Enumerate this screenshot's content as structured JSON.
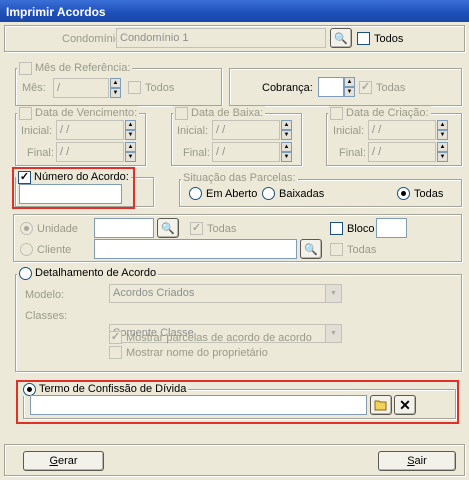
{
  "window": {
    "title": "Imprimir Acordos"
  },
  "condominio": {
    "label": "Condomínio:",
    "value": "Condomínio 1",
    "todos_label": "Todos"
  },
  "mes_ref": {
    "legend": "Mês de Referência:",
    "mes_label": "Mês:",
    "mes_value": "/",
    "todos_label": "Todos"
  },
  "cobranca": {
    "label": "Cobrança:",
    "value": "",
    "todas_label": "Todas"
  },
  "vencimento": {
    "legend": "Data de Vencimento:",
    "inicial_label": "Inicial:",
    "inicial_value": "/ /",
    "final_label": "Final:",
    "final_value": "/ /"
  },
  "baixa": {
    "legend": "Data de Baixa:",
    "inicial_label": "Inicial:",
    "inicial_value": "/ /",
    "final_label": "Final:",
    "final_value": "/ /"
  },
  "criacao": {
    "legend": "Data de Criação:",
    "inicial_label": "Inicial:",
    "inicial_value": "/ /",
    "final_label": "Final:",
    "final_value": "/ /"
  },
  "numero_acordo": {
    "legend": "Número do Acordo:",
    "value": ""
  },
  "situacao": {
    "legend": "Situação das Parcelas:",
    "em_aberto": "Em Aberto",
    "baixadas": "Baixadas",
    "todas": "Todas"
  },
  "unidade": {
    "label": "Unidade",
    "value": "",
    "todas_label": "Todas",
    "bloco_label": "Bloco",
    "bloco_value": ""
  },
  "cliente": {
    "label": "Cliente",
    "value": "",
    "todas_label": "Todas"
  },
  "detalhamento": {
    "legend": "Detalhamento de Acordo",
    "modelo_label": "Modelo:",
    "modelo_value": "Acordos Criados",
    "classes_label": "Classes:",
    "classes_value": "Somente Classe",
    "mostrar_parcelas": "Mostrar parcelas de acordo de acordo",
    "mostrar_nome": "Mostrar nome do proprietário"
  },
  "termo": {
    "legend": "Termo de Confissão de Dívida",
    "value": ""
  },
  "footer": {
    "gerar_rest": "erar",
    "gerar_key": "G",
    "sair_rest": "air",
    "sair_key": "S"
  },
  "colors": {
    "highlight": "#e0302a",
    "titlebar": "#1d4fb8"
  }
}
